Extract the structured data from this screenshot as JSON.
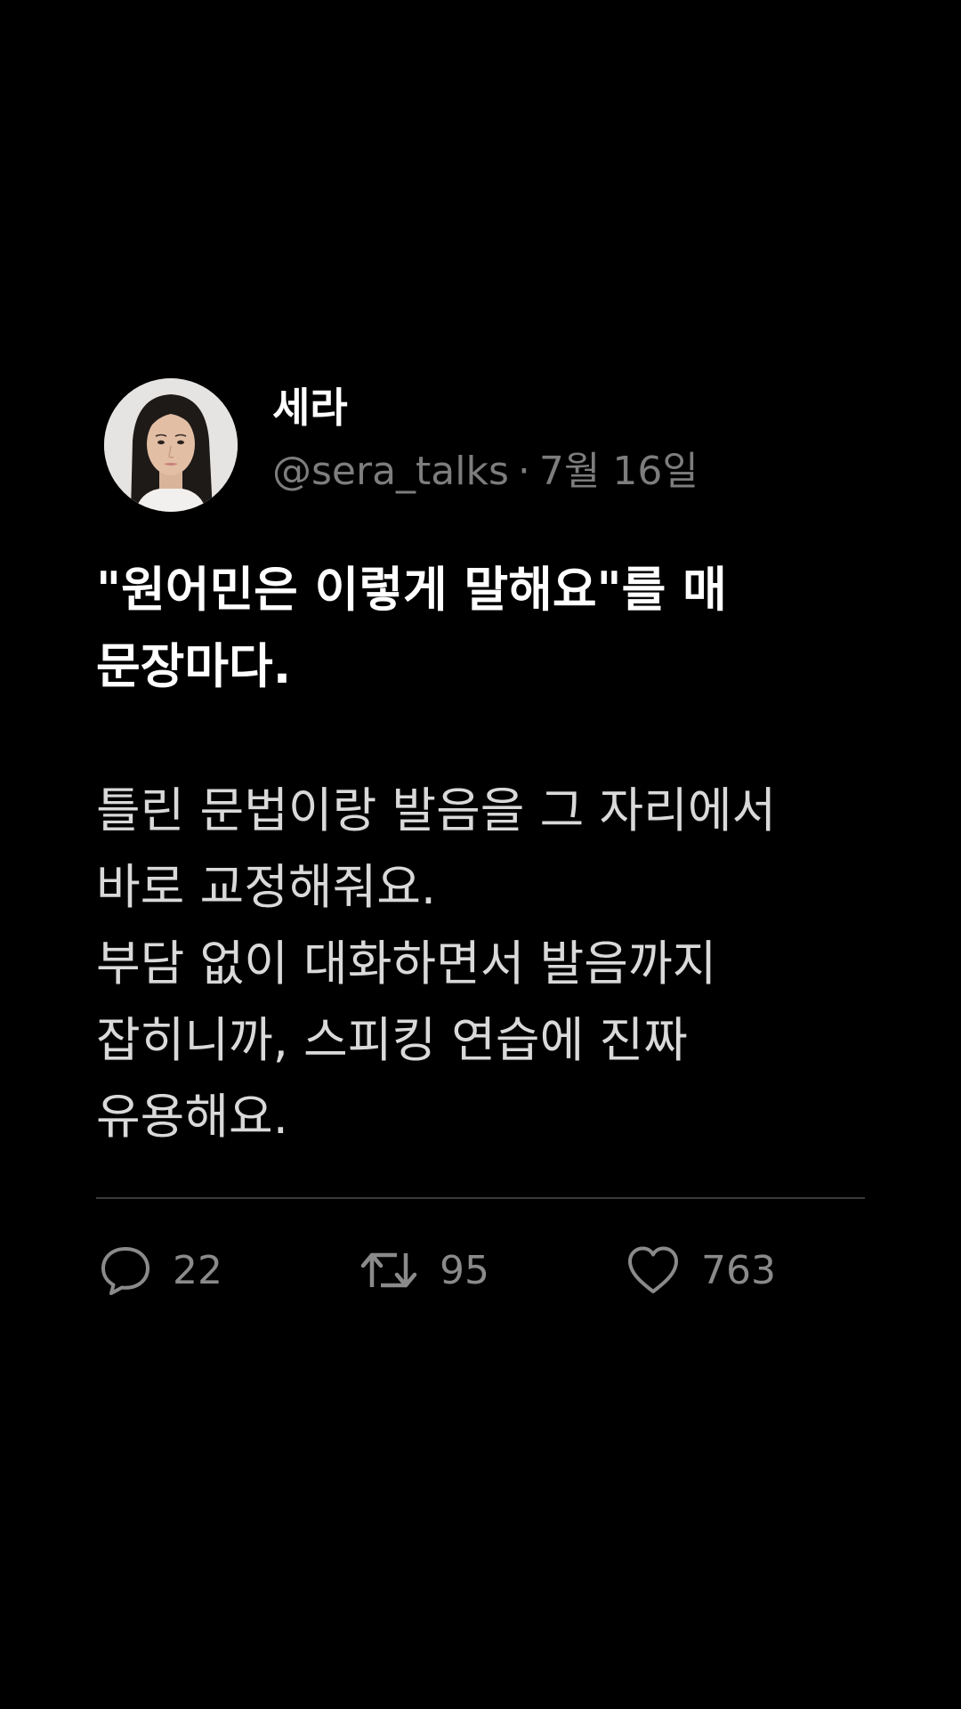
{
  "post": {
    "author": {
      "display_name": "세라",
      "handle": "@sera_talks",
      "separator": "·",
      "date": "7월 16일",
      "avatar_icon": "profile-photo"
    },
    "headline_lines": [
      "\"원어민은 이렇게 말해요\"를 매",
      "문장마다."
    ],
    "body_lines": [
      "틀린 문법이랑 발음을 그 자리에서",
      "바로 교정해줘요.",
      "부담 없이 대화하면서 발음까지",
      "잡히니까, 스피킹 연습에 진짜",
      "유용해요."
    ],
    "actions": {
      "reply": {
        "icon": "reply-bubble-icon",
        "count": "22"
      },
      "retweet": {
        "icon": "retweet-icon",
        "count": "95"
      },
      "like": {
        "icon": "heart-icon",
        "count": "763"
      }
    }
  },
  "colors": {
    "background": "#000000",
    "primary_text": "#ffffff",
    "body_text": "#d9d9d9",
    "secondary_text": "#7d7d7d",
    "divider": "#3a3a3a"
  }
}
